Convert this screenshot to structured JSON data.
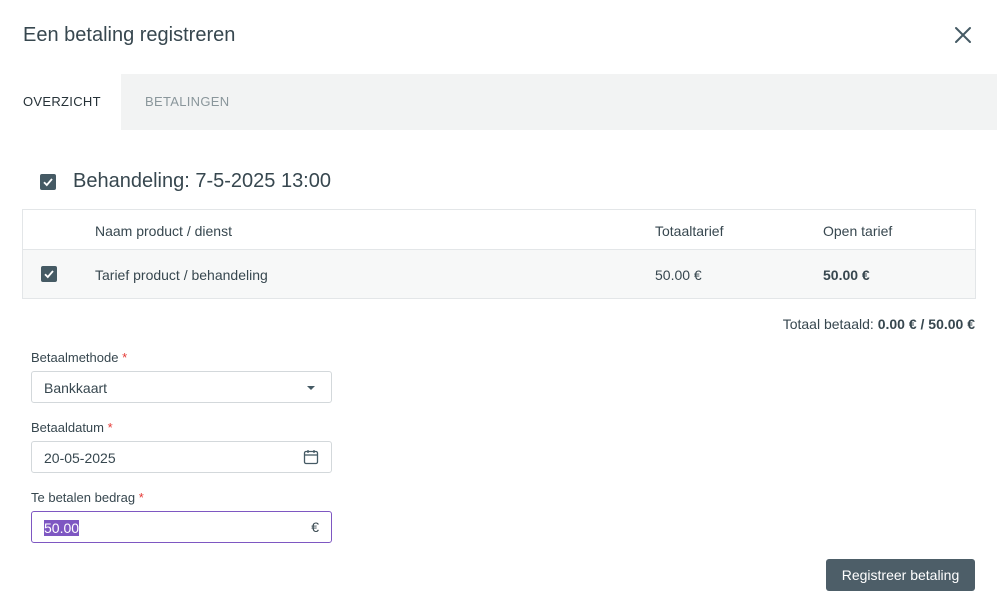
{
  "dialog": {
    "title": "Een betaling registreren"
  },
  "tabs": [
    {
      "label": "OVERZICHT",
      "active": true
    },
    {
      "label": "BETALINGEN",
      "active": false
    }
  ],
  "treatment": {
    "checked": true,
    "title": "Behandeling: 7-5-2025 13:00"
  },
  "table": {
    "headers": [
      "Naam product / dienst",
      "Totaaltarief",
      "Open tarief"
    ],
    "rows": [
      {
        "checked": true,
        "name": "Tarief product / behandeling",
        "total": "50.00 €",
        "open": "50.00 €"
      }
    ]
  },
  "summary": {
    "label": "Totaal betaald:",
    "value": "0.00 € / 50.00 €"
  },
  "form": {
    "method": {
      "label": "Betaalmethode",
      "required_mark": "*",
      "value": "Bankkaart"
    },
    "date": {
      "label": "Betaaldatum",
      "required_mark": "*",
      "value": "20-05-2025"
    },
    "amount": {
      "label": "Te betalen bedrag",
      "required_mark": "*",
      "value": "50.00",
      "currency": "€"
    }
  },
  "actions": {
    "submit_label": "Registreer betaling"
  },
  "colors": {
    "primary_button": "#4d5e68",
    "focus": "#7e57c2",
    "required": "#e53935"
  },
  "icons": [
    "close-icon",
    "checkbox-checked-icon",
    "dropdown-caret-icon",
    "calendar-icon"
  ]
}
